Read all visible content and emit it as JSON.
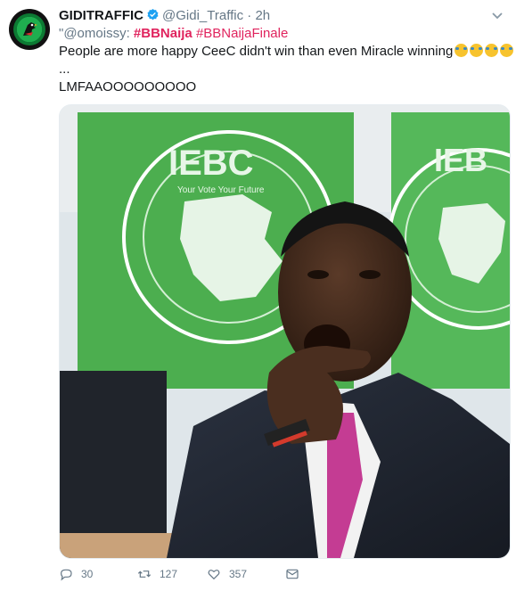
{
  "tweet": {
    "author_name": "GIDITRAFFIC",
    "author_handle": "@Gidi_Traffic",
    "separator": "·",
    "time": "2h",
    "quote_prefix": "\"@omoissy: ",
    "hashtag_1": "#BBNaija",
    "hashtag_2": "#BBNaijaFinale",
    "text_line": "People are more happy CeeC didn't win than even Miracle winning",
    "ellipsis": "...",
    "last_line": "LMFAAOOOOOOOOO",
    "image_sign_text": "IEBC",
    "image_sign_subtext": "Your Vote Your Future",
    "stats": {
      "replies": "30",
      "retweets": "127",
      "likes": "357"
    }
  },
  "icons": {
    "avatar": "giditraffic-bird-logo",
    "verified": "verified-badge-icon",
    "menu": "chevron-down-icon",
    "reply": "reply-icon",
    "retweet": "retweet-icon",
    "like": "heart-icon",
    "dm": "envelope-icon",
    "emoji": "tears-of-joy-emoji"
  },
  "colors": {
    "link": "#e0245e",
    "verified": "#1da1f2",
    "secondary_text": "#657786",
    "iebc_green": "#4cae4f"
  }
}
